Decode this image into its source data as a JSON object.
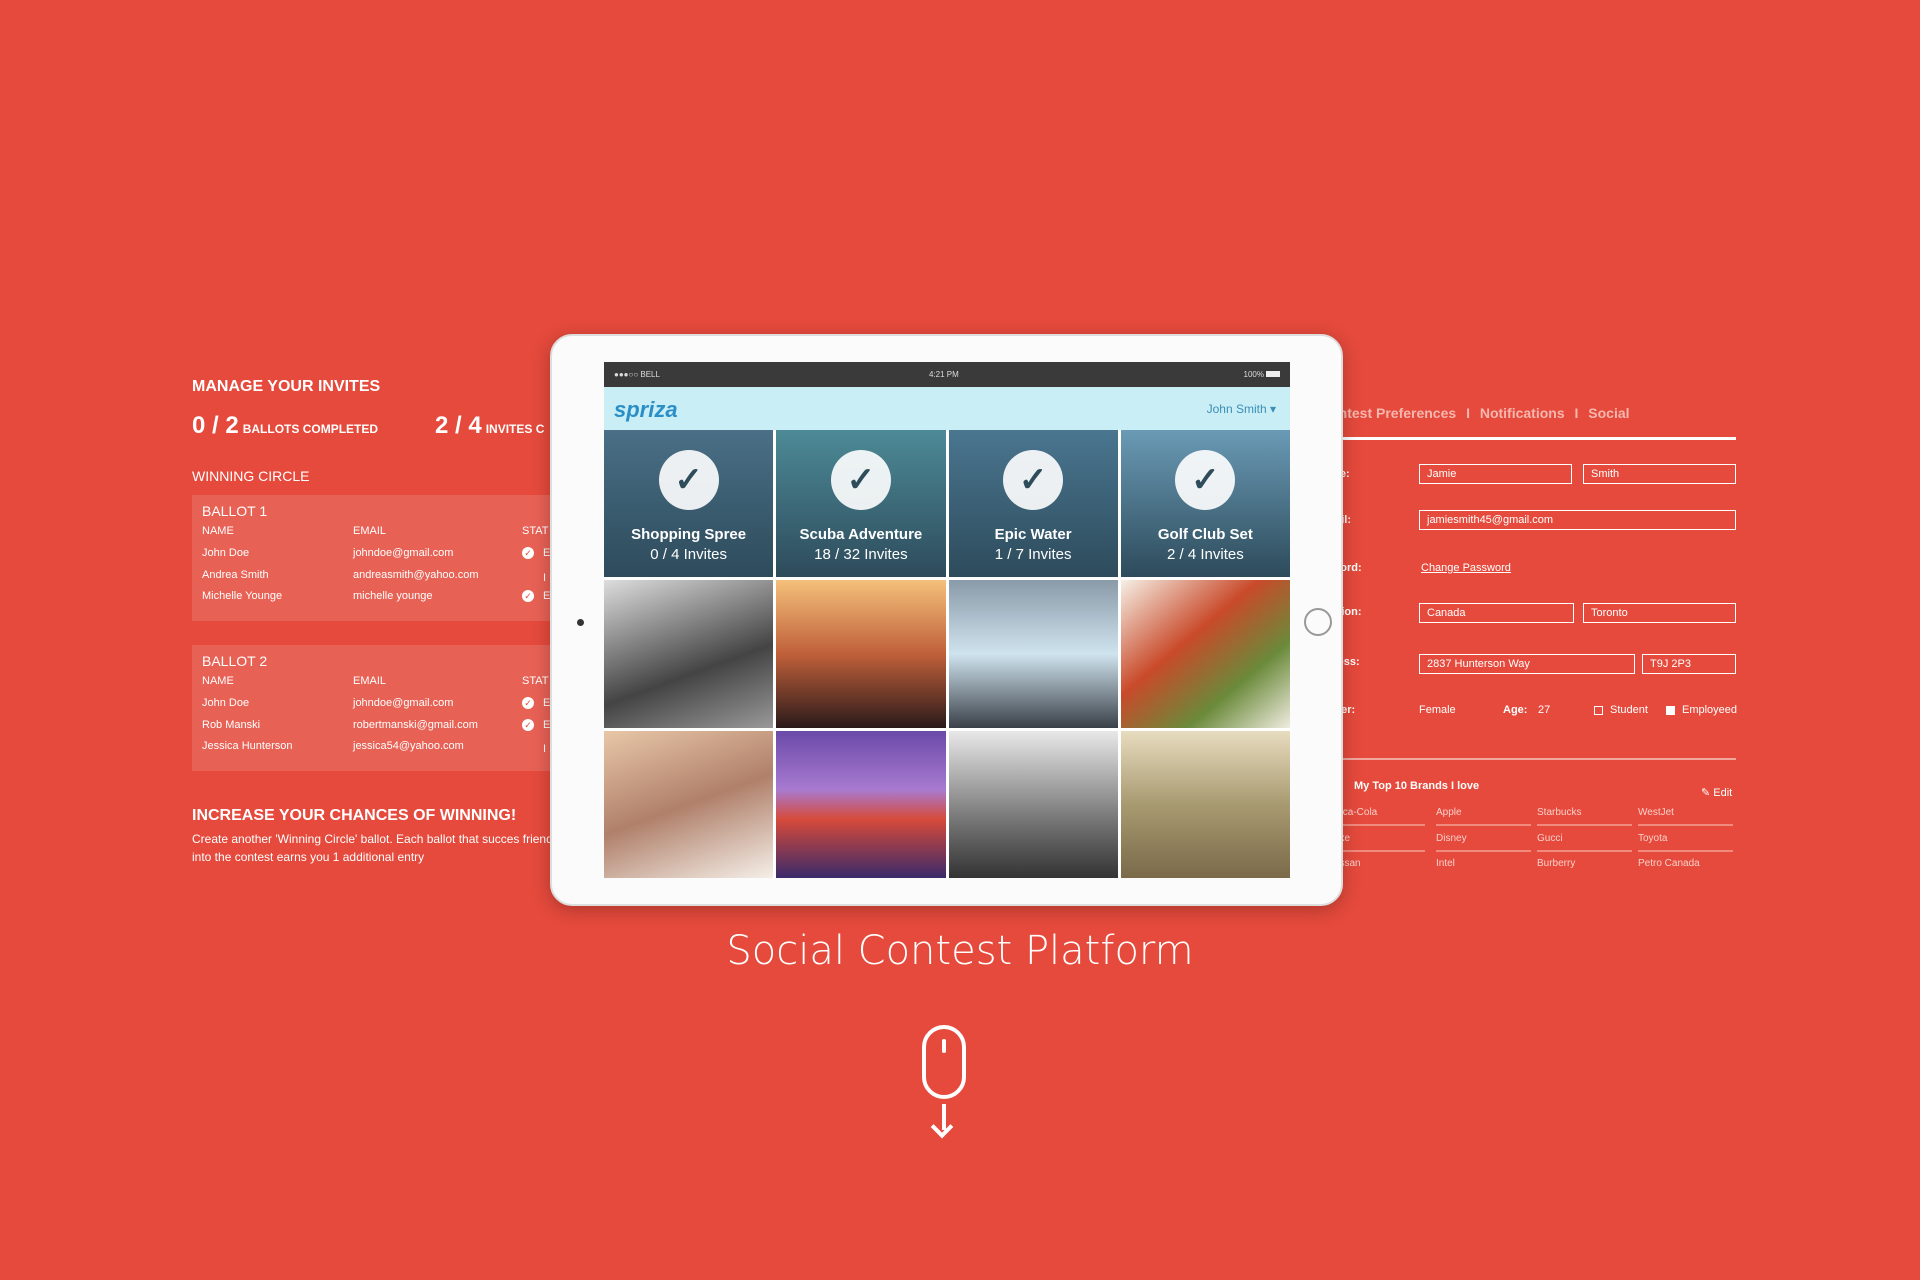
{
  "left_panel": {
    "title": "MANAGE YOUR INVITES",
    "ballots_count": "0 / 2",
    "ballots_label": "BALLOTS COMPLETED",
    "invites_count": "2 / 4",
    "invites_label": "INVITES C",
    "section": "WINNING CIRCLE",
    "columns": [
      "NAME",
      "EMAIL",
      "STAT"
    ],
    "ballots": [
      {
        "title": "BALLOT 1",
        "rows": [
          {
            "name": "John Doe",
            "email": "johndoe@gmail.com",
            "status": "E",
            "checked": true
          },
          {
            "name": "Andrea Smith",
            "email": "andreasmith@yahoo.com",
            "status": "I",
            "checked": false
          },
          {
            "name": "Michelle Younge",
            "email": "michelle younge",
            "status": "E",
            "checked": true
          }
        ]
      },
      {
        "title": "BALLOT 2",
        "rows": [
          {
            "name": "John Doe",
            "email": "johndoe@gmail.com",
            "status": "E",
            "checked": true
          },
          {
            "name": "Rob Manski",
            "email": "robertmanski@gmail.com",
            "status": "E",
            "checked": true
          },
          {
            "name": "Jessica Hunterson",
            "email": "jessica54@yahoo.com",
            "status": "I",
            "checked": false
          }
        ]
      }
    ],
    "promo_title": "INCREASE YOUR CHANCES OF WINNING!",
    "promo_text": "Create another 'Winning Circle' ballot. Each ballot that succes friends entering into the contest earns you 1 additional entry"
  },
  "tablet": {
    "status": {
      "carrier": "●●●○○ BELL",
      "time": "4:21 PM",
      "battery": "100%"
    },
    "logo": "spriza",
    "user": "John Smith",
    "contests": [
      {
        "name": "Shopping Spree",
        "invites": "0 / 4 Invites",
        "color": "#4a6f86"
      },
      {
        "name": "Scuba Adventure",
        "invites": "18 / 32 Invites",
        "color": "#4d8a97"
      },
      {
        "name": "Epic Water",
        "invites": "1 / 7 Invites",
        "color": "#4a7690"
      },
      {
        "name": "Golf Club Set",
        "invites": "2 / 4 Invites",
        "color": "#6a9ab5"
      }
    ]
  },
  "right_panel": {
    "tabs": [
      "Contest Preferences",
      "Notifications",
      "Social"
    ],
    "tab_separator": "I",
    "labels": {
      "name": "Name:",
      "email": "Email:",
      "password": "Password:",
      "location": "Location:",
      "address": "Address:",
      "gender": "Gender:",
      "age": "Age:"
    },
    "first_name": "Jamie",
    "last_name": "Smith",
    "email": "jamiesmith45@gmail.com",
    "change_password": "Change Password",
    "country": "Canada",
    "city": "Toronto",
    "street": "2837 Hunterson Way",
    "postal": "T9J 2P3",
    "gender": "Female",
    "age": "27",
    "student_label": "Student",
    "student_checked": false,
    "employed_label": "Employeed",
    "employed_checked": true,
    "brands_title": "My Top 10 Brands I love",
    "edit_label": "Edit",
    "brands": [
      "Coca-Cola",
      "Apple",
      "Starbucks",
      "WestJet",
      "Nike",
      "Disney",
      "Gucci",
      "Toyota",
      "Nissan",
      "Intel",
      "Burberry",
      "Petro Canada"
    ]
  },
  "caption": "Social Contest Platform"
}
